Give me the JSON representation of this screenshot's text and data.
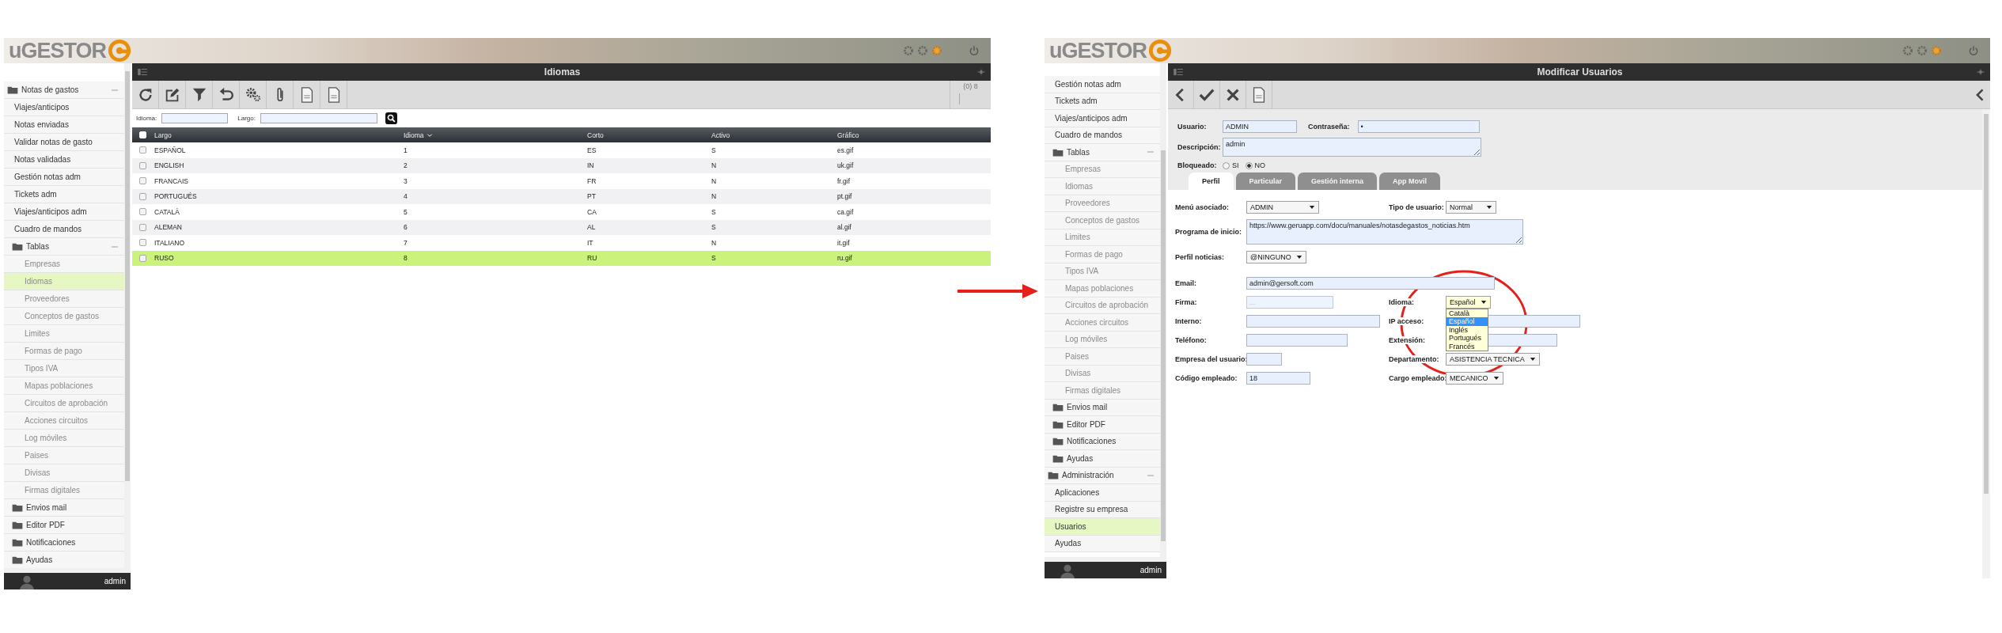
{
  "left_screen": {
    "logo": "uGESTOR",
    "title": "Idiomas",
    "sidebar": [
      {
        "label": "Notas de gastos",
        "kind": "folder",
        "expanded": true,
        "selected": false,
        "children": [
          {
            "label": "Viajes/anticipos",
            "kind": "item",
            "selected": false
          },
          {
            "label": "Notas enviadas",
            "kind": "item",
            "selected": false
          },
          {
            "label": "Validar notas de gasto",
            "kind": "item",
            "selected": false
          },
          {
            "label": "Notas validadas",
            "kind": "item",
            "selected": false
          },
          {
            "label": "Gestión notas adm",
            "kind": "item",
            "selected": false
          },
          {
            "label": "Tickets adm",
            "kind": "item",
            "selected": false
          },
          {
            "label": "Viajes/anticipos adm",
            "kind": "item",
            "selected": false
          },
          {
            "label": "Cuadro de mandos",
            "kind": "item",
            "selected": false
          },
          {
            "label": "Tablas",
            "kind": "folder",
            "expanded": true,
            "selected": false,
            "children": [
              {
                "label": "Empresas",
                "kind": "item",
                "selected": false
              },
              {
                "label": "Idiomas",
                "kind": "item",
                "selected": true
              },
              {
                "label": "Proveedores",
                "kind": "item",
                "selected": false
              },
              {
                "label": "Conceptos de gastos",
                "kind": "item",
                "selected": false
              },
              {
                "label": "Limites",
                "kind": "item",
                "selected": false
              },
              {
                "label": "Formas de pago",
                "kind": "item",
                "selected": false
              },
              {
                "label": "Tipos IVA",
                "kind": "item",
                "selected": false
              },
              {
                "label": "Mapas poblaciones",
                "kind": "item",
                "selected": false
              },
              {
                "label": "Circuitos de aprobación",
                "kind": "item",
                "selected": false
              },
              {
                "label": "Acciones circuitos",
                "kind": "item",
                "selected": false
              },
              {
                "label": "Log móviles",
                "kind": "item",
                "selected": false
              },
              {
                "label": "Paises",
                "kind": "item",
                "selected": false
              },
              {
                "label": "Divisas",
                "kind": "item",
                "selected": false
              },
              {
                "label": "Firmas digitales",
                "kind": "item",
                "selected": false
              }
            ]
          },
          {
            "label": "Envios mail",
            "kind": "folder",
            "expanded": false,
            "selected": false
          },
          {
            "label": "Editor PDF",
            "kind": "folder",
            "expanded": false,
            "selected": false
          },
          {
            "label": "Notificaciones",
            "kind": "folder",
            "expanded": false,
            "selected": false
          },
          {
            "label": "Ayudas",
            "kind": "folder",
            "expanded": false,
            "selected": false
          }
        ]
      }
    ],
    "user": "admin",
    "record_count": "(0) 8",
    "filters": [
      {
        "label": "Idioma:"
      },
      {
        "label": "Largo:"
      }
    ],
    "table": {
      "checked": false,
      "columns": [
        {
          "label": "Largo",
          "sorted": false
        },
        {
          "label": "Idioma",
          "sorted": true
        },
        {
          "label": "Corto",
          "sorted": false
        },
        {
          "label": "Activo",
          "sorted": false
        },
        {
          "label": "Gráfico",
          "sorted": false
        }
      ],
      "rows": [
        {
          "cells": [
            "ESPAÑOL",
            "1",
            "ES",
            "S",
            "es.gif"
          ],
          "checked": false,
          "selected": false
        },
        {
          "cells": [
            "ENGLISH",
            "2",
            "IN",
            "N",
            "uk.gif"
          ],
          "checked": false,
          "selected": false
        },
        {
          "cells": [
            "FRANCAIS",
            "3",
            "FR",
            "N",
            "fr.gif"
          ],
          "checked": false,
          "selected": false
        },
        {
          "cells": [
            "PORTUGUÉS",
            "4",
            "PT",
            "N",
            "pt.gif"
          ],
          "checked": false,
          "selected": false
        },
        {
          "cells": [
            "CATALÀ",
            "5",
            "CA",
            "S",
            "ca.gif"
          ],
          "checked": false,
          "selected": false
        },
        {
          "cells": [
            "ALEMAN",
            "6",
            "AL",
            "S",
            "al.gif"
          ],
          "checked": false,
          "selected": false
        },
        {
          "cells": [
            "ITALIANO",
            "7",
            "IT",
            "N",
            "it.gif"
          ],
          "checked": false,
          "selected": false
        },
        {
          "cells": [
            "RUSO",
            "8",
            "RU",
            "S",
            "ru.gif"
          ],
          "checked": false,
          "selected": true
        }
      ]
    }
  },
  "right_screen": {
    "logo": "uGESTOR",
    "title": "Modificar Usuarios",
    "sidebar": [
      {
        "kind": "group",
        "children": [
          {
            "label": "Gestión notas adm",
            "kind": "item",
            "selected": false
          },
          {
            "label": "Tickets adm",
            "kind": "item",
            "selected": false
          },
          {
            "label": "Viajes/anticipos adm",
            "kind": "item",
            "selected": false
          },
          {
            "label": "Cuadro de mandos",
            "kind": "item",
            "selected": false
          },
          {
            "label": "Tablas",
            "kind": "folder",
            "expanded": true,
            "selected": false,
            "children": [
              {
                "label": "Empresas",
                "kind": "item",
                "selected": false
              },
              {
                "label": "Idiomas",
                "kind": "item",
                "selected": false
              },
              {
                "label": "Proveedores",
                "kind": "item",
                "selected": false
              },
              {
                "label": "Conceptos de gastos",
                "kind": "item",
                "selected": false
              },
              {
                "label": "Limites",
                "kind": "item",
                "selected": false
              },
              {
                "label": "Formas de pago",
                "kind": "item",
                "selected": false
              },
              {
                "label": "Tipos IVA",
                "kind": "item",
                "selected": false
              },
              {
                "label": "Mapas poblaciones",
                "kind": "item",
                "selected": false
              },
              {
                "label": "Circuitos de aprobación",
                "kind": "item",
                "selected": false
              },
              {
                "label": "Acciones circuitos",
                "kind": "item",
                "selected": false
              },
              {
                "label": "Log móviles",
                "kind": "item",
                "selected": false
              },
              {
                "label": "Paises",
                "kind": "item",
                "selected": false
              },
              {
                "label": "Divisas",
                "kind": "item",
                "selected": false
              },
              {
                "label": "Firmas digitales",
                "kind": "item",
                "selected": false
              }
            ]
          },
          {
            "label": "Envios mail",
            "kind": "folder",
            "expanded": false,
            "selected": false
          },
          {
            "label": "Editor PDF",
            "kind": "folder",
            "expanded": false,
            "selected": false
          },
          {
            "label": "Notificaciones",
            "kind": "folder",
            "expanded": false,
            "selected": false
          },
          {
            "label": "Ayudas",
            "kind": "folder",
            "expanded": false,
            "selected": false
          }
        ]
      },
      {
        "label": "Administración",
        "kind": "folder",
        "expanded": true,
        "selected": false,
        "children": [
          {
            "label": "Aplicaciones",
            "kind": "item",
            "selected": false
          },
          {
            "label": "Registre su empresa",
            "kind": "item",
            "selected": false
          },
          {
            "label": "Usuarios",
            "kind": "item",
            "selected": true
          },
          {
            "label": "Ayudas",
            "kind": "item",
            "selected": false
          }
        ]
      }
    ],
    "user": "admin",
    "account": {
      "fields": [
        {
          "label": "Usuario:",
          "kind": "input",
          "value": "ADMIN"
        },
        {
          "label": "Contraseña:",
          "kind": "password",
          "value": "•"
        },
        {
          "label": "Descripción:",
          "kind": "textarea",
          "value": "admin"
        }
      ],
      "blocked": {
        "label": "Bloqueado:",
        "options": [
          {
            "label": "SI",
            "selected": false
          },
          {
            "label": "NO",
            "selected": true
          }
        ]
      }
    },
    "tabs": [
      {
        "label": "Perfil",
        "selected": true
      },
      {
        "label": "Particular",
        "selected": false
      },
      {
        "label": "Gestión interna",
        "selected": false
      },
      {
        "label": "App Movil",
        "selected": false
      }
    ],
    "profile": {
      "rows": [
        [
          {
            "label": "Menú asociado:",
            "kind": "select",
            "value": "ADMIN",
            "open": false
          },
          {
            "label": "Tipo de usuario:",
            "kind": "select",
            "value": "Normal",
            "open": false
          }
        ],
        [
          {
            "label": "Programa de inicio:",
            "kind": "textarea",
            "value": "https://www.geruapp.com/docu/manuales/notasdegastos_noticias.htm"
          }
        ],
        [
          {
            "label": "Perfil noticias:",
            "kind": "select",
            "value": "@NINGUNO",
            "open": false
          }
        ],
        [
          {
            "label": "Email:",
            "kind": "input",
            "value": "admin@gersoft.com"
          }
        ],
        [
          {
            "label": "Firma:",
            "kind": "input",
            "placeholder": "..."
          },
          {
            "label": "Idioma:",
            "kind": "select",
            "value": "Español",
            "open": true
          }
        ],
        [
          {
            "label": "Interno:",
            "kind": "input"
          },
          {
            "label": "IP acceso:",
            "kind": "input"
          }
        ],
        [
          {
            "label": "Teléfono:",
            "kind": "input"
          },
          {
            "label": "Extensión:",
            "kind": "input"
          }
        ],
        [
          {
            "label": "Empresa del usuario:",
            "kind": "input"
          },
          {
            "label": "Departamento:",
            "kind": "select",
            "value": "ASISTENCIA TECNICA",
            "open": false
          }
        ],
        [
          {
            "label": "Código empleado:",
            "kind": "input",
            "value": "18"
          },
          {
            "label": "Cargo empleado:",
            "kind": "select",
            "value": "MECANICO",
            "open": false
          }
        ]
      ],
      "dropdown": {
        "options": [
          {
            "label": "Català",
            "selected": false
          },
          {
            "label": "Español",
            "selected": true
          },
          {
            "label": "Inglés",
            "selected": false
          },
          {
            "label": "Portugués",
            "selected": false
          },
          {
            "label": "Francés",
            "selected": false
          }
        ]
      }
    }
  }
}
